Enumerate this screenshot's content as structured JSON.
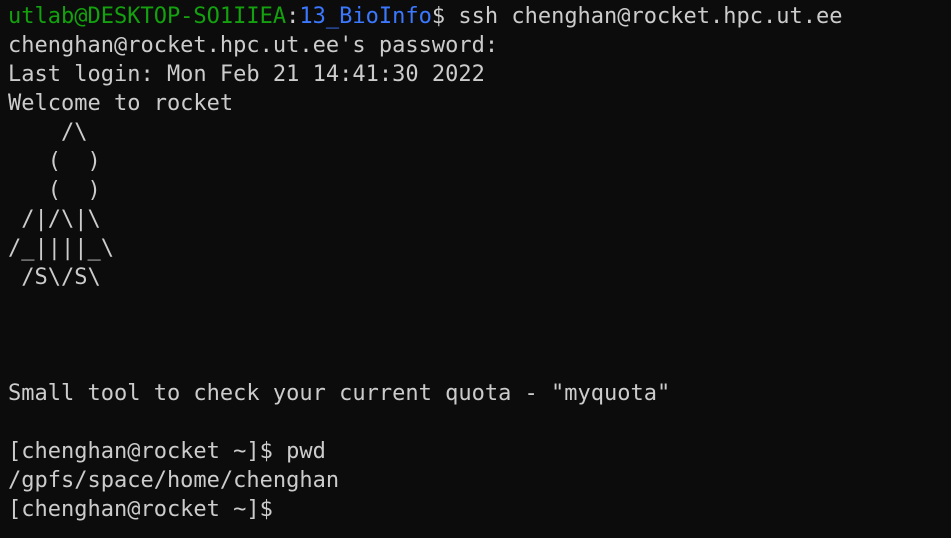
{
  "colors": {
    "background": "#0c0c0c",
    "foreground": "#cccccc",
    "user_host": "#13a10e",
    "cwd": "#3b78ff"
  },
  "local_prompt": {
    "user_host": "utlab@DESKTOP-SO1IIEA",
    "separator": ":",
    "cwd": "13_BioInfo",
    "symbol": "$",
    "command": " ssh chenghan@rocket.hpc.ut.ee"
  },
  "lines": {
    "password_prompt": "chenghan@rocket.hpc.ut.ee's password:",
    "last_login": "Last login: Mon Feb 21 14:41:30 2022",
    "welcome": "Welcome to rocket",
    "art_1": "    /\\",
    "art_2": "   (  )",
    "art_3": "   (  )",
    "art_4": " /|/\\|\\",
    "art_5": "/_||||_\\",
    "art_6": " /S\\/S\\",
    "quota_tip": "Small tool to check your current quota - \"myquota\"",
    "prompt_pwd": "[chenghan@rocket ~]$ pwd",
    "pwd_output": "/gpfs/space/home/chenghan",
    "prompt_current": "[chenghan@rocket ~]$ "
  }
}
